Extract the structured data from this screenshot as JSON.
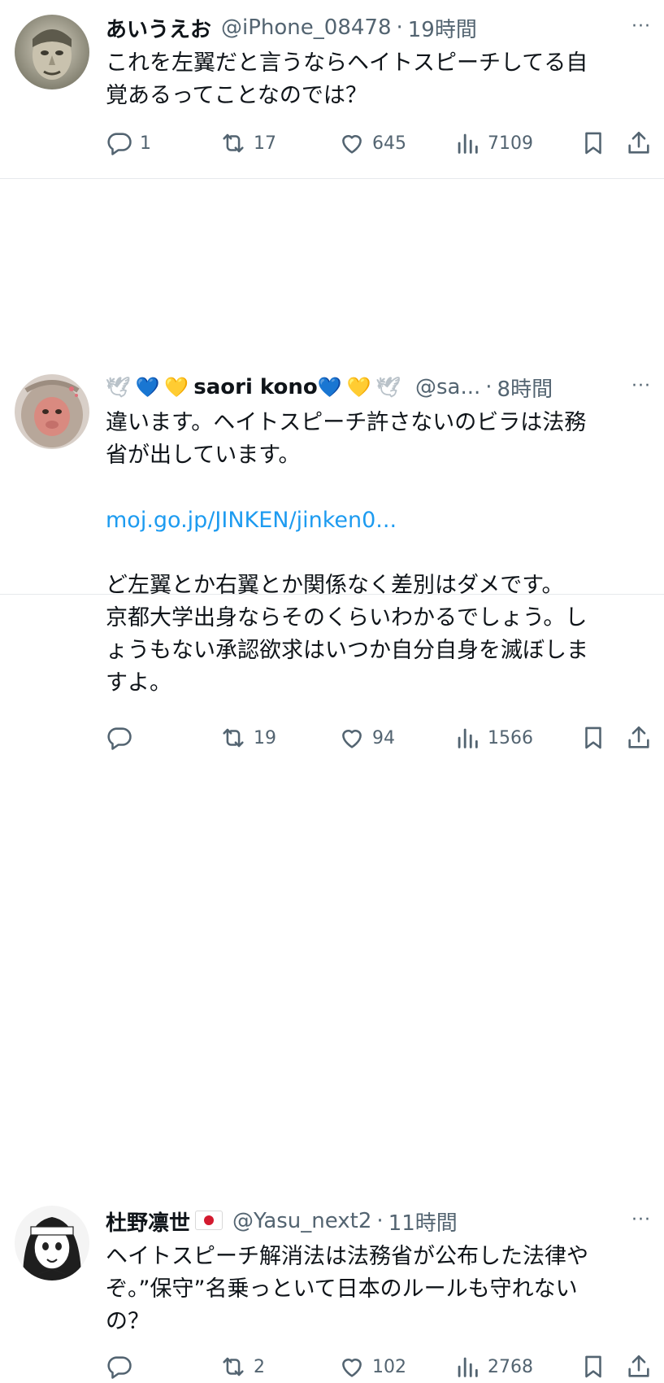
{
  "tweets": [
    {
      "display_name": "あいうえお",
      "handle": "@iPhone_08478",
      "separator": "·",
      "time": "19時間",
      "more": "···",
      "text": "これを左翼だと言うならヘイトスピーチしてる自\n覚あるってことなのでは？",
      "reply_count": "1",
      "retweet_count": "17",
      "like_count": "645",
      "view_count": "7109"
    },
    {
      "name_prefix_emojis": [
        "🕊",
        "💙",
        "💛"
      ],
      "display_name": "saori kono",
      "name_suffix_emojis": [
        "💙",
        "💛",
        "🕊"
      ],
      "handle": "@sa...",
      "separator": "·",
      "time": "8時間",
      "more": "···",
      "text_line1": "違います。ヘイトスピーチ許さないのビラは法務\n省が出しています。",
      "link": "moj.go.jp/JINKEN/jinken0...",
      "text_line2": "ど左翼とか右翼とか関係なく差別はダメです。\n京都大学出身ならそのくらいわかるでしょう。し\nょうもない承認欲求はいつか自分自身を滅ぼしま\nすよ。",
      "reply_count": "",
      "retweet_count": "19",
      "like_count": "94",
      "view_count": "1566"
    },
    {
      "display_name": "杜野凛世",
      "handle": "@Yasu_next2",
      "separator": "·",
      "time": "11時間",
      "more": "···",
      "text": "ヘイトスピーチ解消法は法務省が公布した法律や\nぞ。”保守”名乗っといて日本のルールも守れない\nの？",
      "reply_count": "",
      "retweet_count": "2",
      "like_count": "102",
      "view_count": "2768"
    }
  ],
  "icons": {
    "reply": "reply-icon",
    "retweet": "retweet-icon",
    "like": "heart-icon",
    "views": "views-icon",
    "bookmark": "bookmark-icon",
    "share": "share-icon",
    "more": "more-icon"
  },
  "colors": {
    "text": "#0f1419",
    "muted": "#536471",
    "link": "#1d9bf0",
    "divider": "#e6e9ec"
  }
}
